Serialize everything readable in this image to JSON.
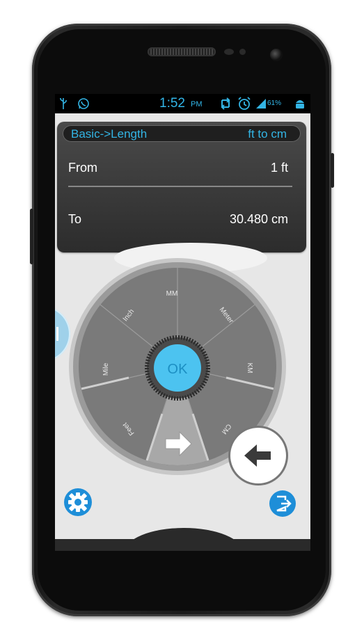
{
  "statusbar": {
    "time": "1:52",
    "ampm": "PM",
    "battery": "61%",
    "icons": [
      "usb-icon",
      "whatsapp-icon",
      "sync-icon",
      "alarm-icon",
      "signal-icon",
      "android-icon"
    ]
  },
  "header": {
    "category": "Basic->Length",
    "conversion": "ft to cm"
  },
  "rows": {
    "from_label": "From",
    "from_value": "1 ft",
    "to_label": "To",
    "to_value": "30.480 cm"
  },
  "wheel": {
    "units": [
      "MM",
      "Meter",
      "KM",
      "CM",
      "Feet",
      "Mile",
      "Inch"
    ],
    "ok_label": "OK"
  },
  "colors": {
    "accent": "#33b5e5",
    "ok_button": "#4cc3f0",
    "action_blue": "#1e8ed8"
  }
}
